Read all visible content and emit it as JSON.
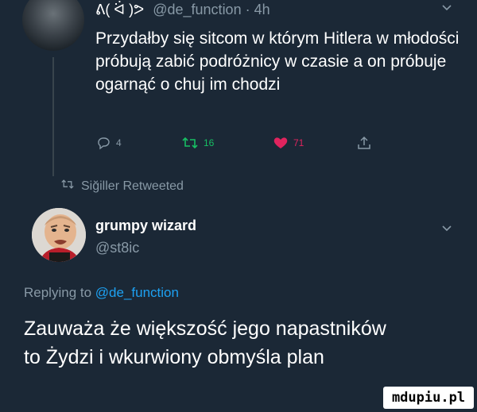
{
  "tweet1": {
    "display_name": "ᕕ( ᐛ )ᕗ",
    "handle_time": "@de_function · 4h",
    "text": "Przydałby się sitcom w którym Hitlera w młodości próbują zabić podróżnicy w czasie a on próbuje ogarnąć o chuj im chodzi",
    "reply_count": "4",
    "retweet_count": "16",
    "like_count": "71"
  },
  "retweeted_by": "Siğiller Retweeted",
  "tweet2": {
    "display_name": "grumpy wizard",
    "handle": "@st8ic",
    "replying_prefix": "Replying to",
    "replying_to": "@de_function",
    "text": "Zauważa że większość jego napastników to Żydzi i wkurwiony obmyśla plan"
  },
  "watermark": "mdupiu.pl",
  "colors": {
    "background": "#1b2836",
    "muted": "#8899a6",
    "link": "#1da1f2",
    "retweet_active": "#17bf63",
    "like_active": "#e0245e"
  },
  "icons": [
    "reply-icon",
    "retweet-icon",
    "like-icon",
    "share-icon",
    "chevron-down-icon"
  ]
}
